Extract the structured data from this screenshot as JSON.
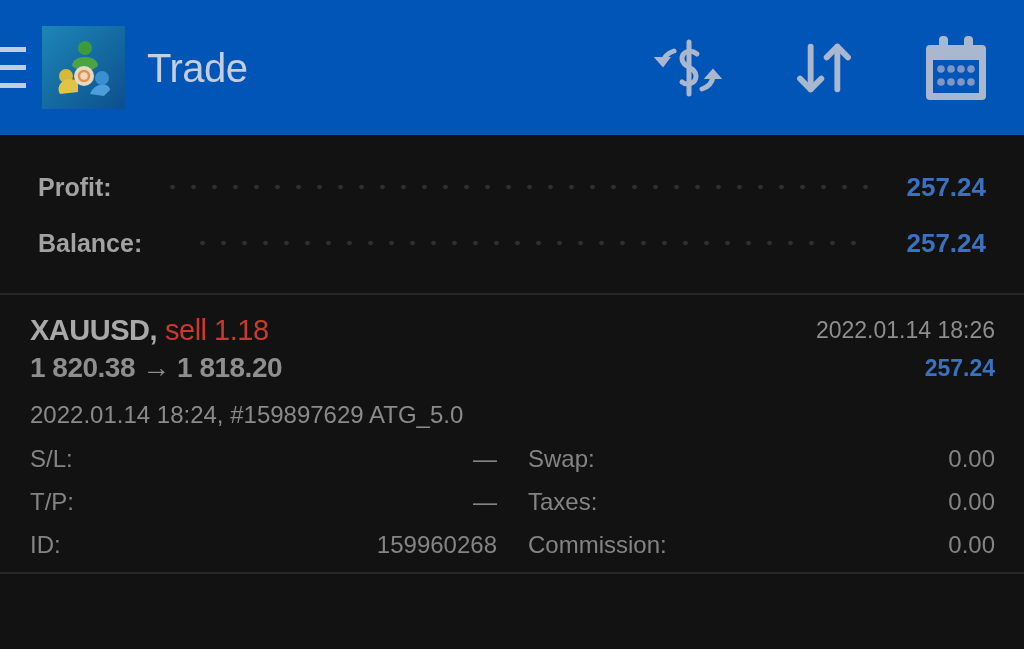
{
  "header": {
    "title": "Trade"
  },
  "summary": [
    {
      "label": "Profit:",
      "value": "257.24"
    },
    {
      "label": "Balance:",
      "value": "257.24"
    }
  ],
  "positions": [
    {
      "symbol": "XAUUSD,",
      "side": "sell 1.18",
      "prices": "1 820.38 → 1 818.20",
      "close_time": "2022.01.14 18:26",
      "profit": "257.24",
      "open_info": "2022.01.14 18:24, #159897629 ATG_5.0",
      "details": [
        {
          "label": "S/L:",
          "value": "—"
        },
        {
          "label": "Swap:",
          "value": "0.00"
        },
        {
          "label": "T/P:",
          "value": "—"
        },
        {
          "label": "Taxes:",
          "value": "0.00"
        },
        {
          "label": "ID:",
          "value": "159960268"
        },
        {
          "label": "Commission:",
          "value": "0.00"
        }
      ]
    }
  ]
}
